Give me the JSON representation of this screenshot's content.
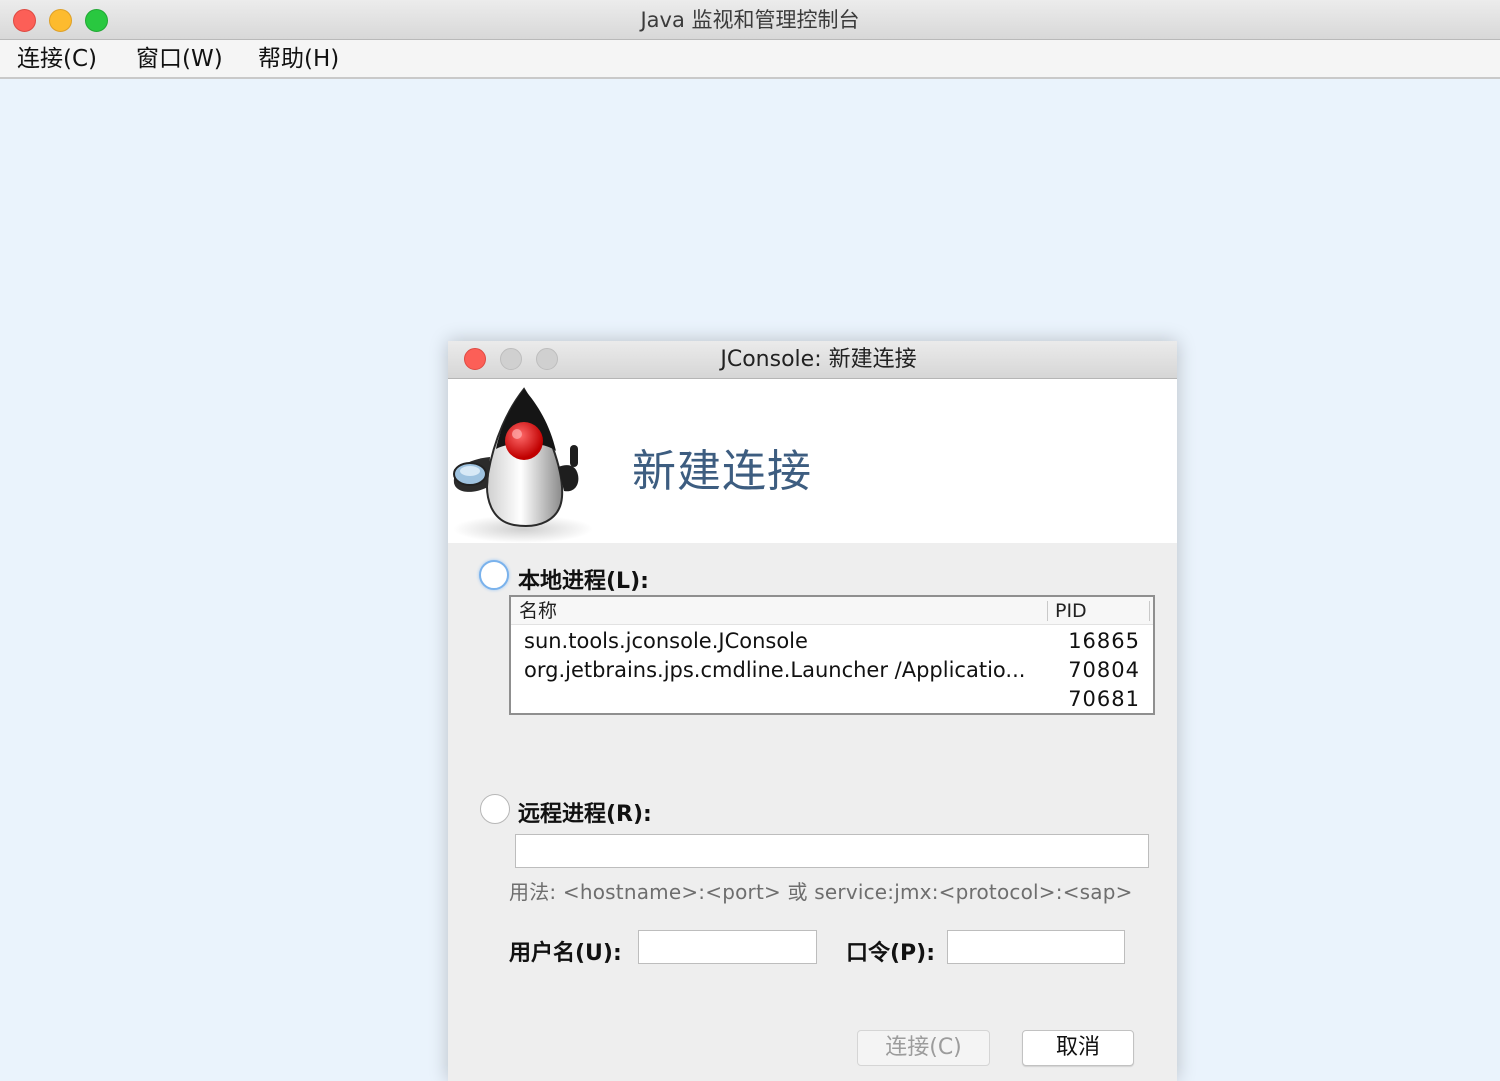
{
  "window": {
    "title": "Java 监视和管理控制台"
  },
  "menubar": {
    "items": [
      {
        "label": "连接(C)"
      },
      {
        "label": "窗口(W)"
      },
      {
        "label": "帮助(H)"
      }
    ]
  },
  "dialog": {
    "title": "JConsole: 新建连接",
    "banner_title": "新建连接",
    "local": {
      "label": "本地进程(L):",
      "selected": true,
      "columns": [
        "名称",
        "PID"
      ],
      "rows": [
        {
          "name": "sun.tools.jconsole.JConsole",
          "pid": "16865"
        },
        {
          "name": "org.jetbrains.jps.cmdline.Launcher /Applicatio...",
          "pid": "70804"
        },
        {
          "name": "",
          "pid": "70681"
        }
      ]
    },
    "remote": {
      "label": "远程进程(R):",
      "selected": false,
      "value": "",
      "usage": "用法: <hostname>:<port> 或 service:jmx:<protocol>:<sap>"
    },
    "credentials": {
      "username_label": "用户名(U):",
      "username_value": "",
      "password_label": "口令(P):",
      "password_value": ""
    },
    "buttons": {
      "connect": "连接(C)",
      "cancel": "取消"
    }
  },
  "colors": {
    "desktop_bg": "#eaf3fc",
    "banner_title": "#3d5d80",
    "close": "#fc5f57",
    "minimize": "#fdbb2e",
    "zoom": "#29c840"
  }
}
